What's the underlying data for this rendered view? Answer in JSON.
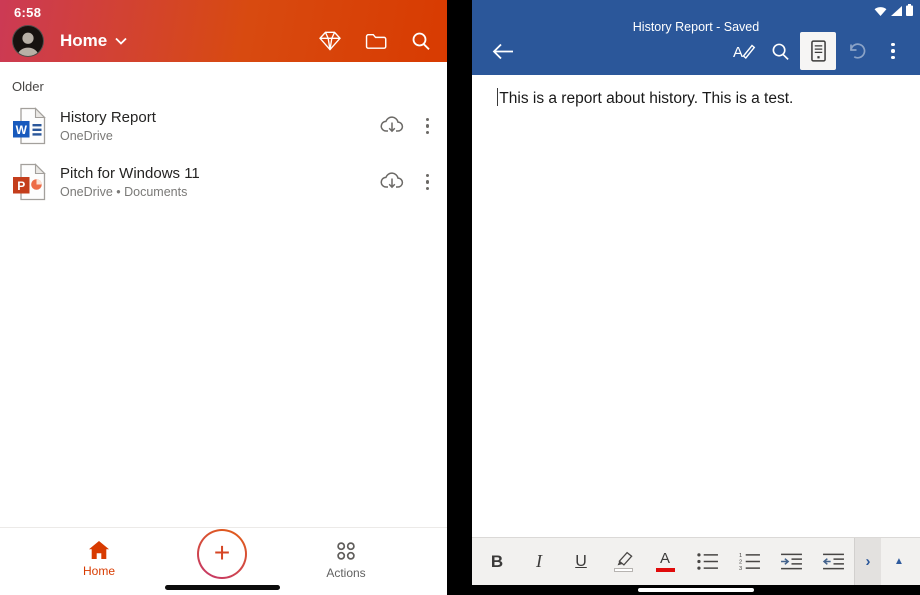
{
  "left_panel": {
    "status_bar": {
      "time": "6:58"
    },
    "header": {
      "title": "Home"
    },
    "files_section": {
      "label": "Older",
      "files": [
        {
          "title": "History Report",
          "location": "OneDrive",
          "file_type": "word"
        },
        {
          "title": "Pitch for Windows 11",
          "location": "OneDrive • Documents",
          "file_type": "powerpoint"
        }
      ]
    },
    "bottom_nav": {
      "home_label": "Home",
      "actions_label": "Actions",
      "fab_glyph": "+"
    }
  },
  "right_panel": {
    "title_bar": {
      "document_title": "History Report - Saved"
    },
    "document": {
      "text": "This is a report about history. This is a test."
    },
    "toolbar": {
      "bold": "B",
      "italic": "I",
      "underline": "U",
      "font_color": "A",
      "more": "›",
      "collapse": "▲"
    }
  },
  "colors": {
    "left_header_gradient_start": "#cc3a55",
    "left_header_gradient_end": "#d83b01",
    "accent_orange": "#d83b01",
    "word_blue": "#2b579a",
    "word_file_square": "#185abd",
    "powerpoint_file_square": "#c43e1c",
    "font_color_swatch": "#e00b0b",
    "highlight_swatch": "#ffffff",
    "toolbar_bg": "#f2f1ef",
    "divider": "#000000"
  }
}
